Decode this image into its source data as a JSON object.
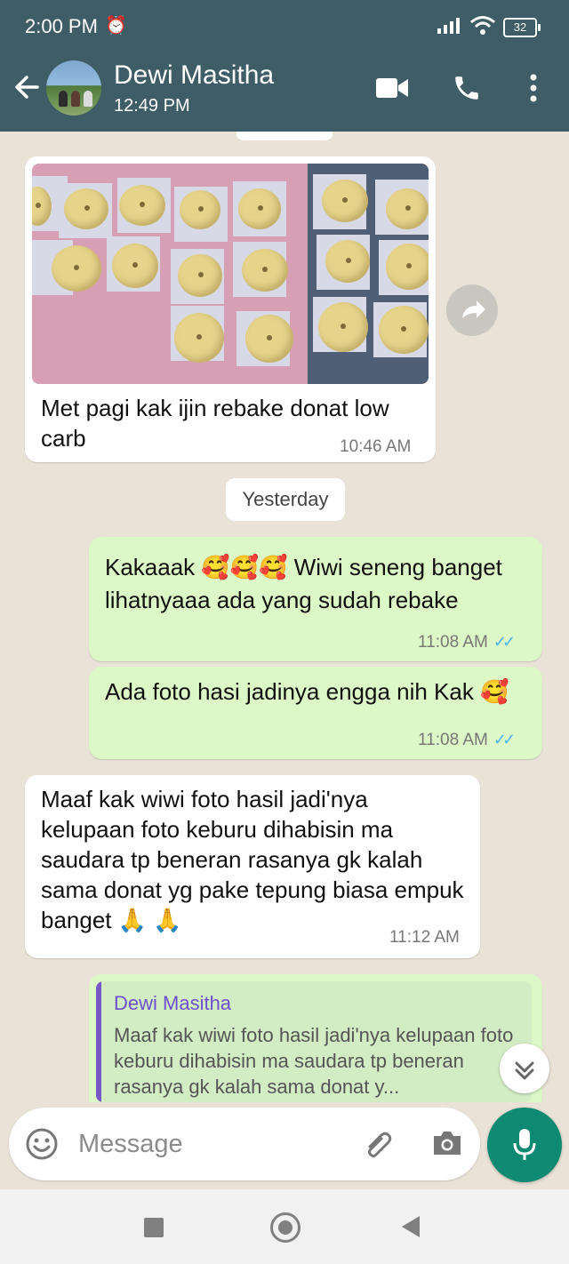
{
  "status": {
    "time": "2:00 PM",
    "battery": "32"
  },
  "contact": {
    "name": "Dewi Masitha",
    "last_seen": "12:49 PM"
  },
  "messages": [
    {
      "text": "Met pagi kak ijin rebake donat low carb",
      "time": "10:46 AM"
    },
    {
      "text": "Kakaaak 🥰🥰🥰 Wiwi seneng banget lihatnyaaa ada yang sudah rebake",
      "time": "11:08 AM",
      "ticks": "✓✓"
    },
    {
      "text": "Ada foto hasi jadinya engga nih Kak 🥰",
      "time": "11:08 AM",
      "ticks": "✓✓"
    },
    {
      "text": "Maaf kak wiwi foto hasil jadi'nya kelupaan foto keburu dihabisin ma saudara tp beneran rasanya gk kalah sama donat yg pake tepung biasa empuk banget 🙏 🙏",
      "time": "11:12 AM"
    }
  ],
  "date_separator": "Yesterday",
  "reply_quote": {
    "name": "Dewi Masitha",
    "text": "Maaf kak wiwi foto hasil jadi'nya kelupaan foto keburu dihabisin ma saudara tp beneran rasanya gk kalah sama donat y..."
  },
  "input": {
    "placeholder": "Message"
  },
  "colors": {
    "header": "#3f5d67",
    "incoming": "#ffffff",
    "outgoing": "#dcf8c6",
    "accent": "#0e8a73",
    "read_ticks": "#4fb6ec"
  },
  "icons": [
    "back-arrow-icon",
    "video-call-icon",
    "phone-icon",
    "more-vert-icon",
    "forward-icon",
    "emoji-icon",
    "attach-icon",
    "camera-icon",
    "mic-icon",
    "chevron-down-icon"
  ]
}
